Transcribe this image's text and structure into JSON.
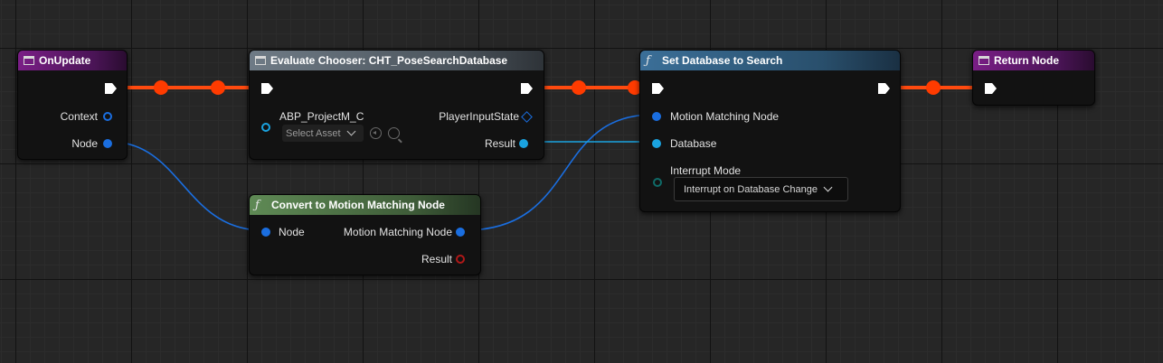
{
  "graph": {
    "colors": {
      "exec_wire": "#ff4a0f",
      "exec_knot": "#ff3b00",
      "data_wire": "#1a6ee0",
      "database_wire": "#1aa3e0"
    }
  },
  "nodes": {
    "on_update": {
      "title": "OnUpdate",
      "icon": "event-node-icon",
      "pins": {
        "context": "Context",
        "node": "Node"
      }
    },
    "evaluate_chooser": {
      "title": "Evaluate Chooser: CHT_PoseSearchDatabase",
      "icon": "chooser-node-icon",
      "pins": {
        "context_object": "ABP_ProjectM_C",
        "player_input_state": "PlayerInputState",
        "result": "Result"
      },
      "asset_picker": {
        "value": "Select Asset"
      }
    },
    "set_database": {
      "title": "Set Database to Search",
      "icon": "function-icon",
      "pins": {
        "motion_matching_node": "Motion Matching Node",
        "database": "Database",
        "interrupt_mode": "Interrupt Mode"
      },
      "interrupt_mode_select": {
        "value": "Interrupt on Database Change"
      }
    },
    "return_node": {
      "title": "Return Node",
      "icon": "event-node-icon"
    },
    "convert": {
      "title": "Convert to Motion Matching Node",
      "icon": "function-icon",
      "pins": {
        "node_in": "Node",
        "motion_matching_node_out": "Motion Matching Node",
        "result": "Result"
      }
    }
  }
}
